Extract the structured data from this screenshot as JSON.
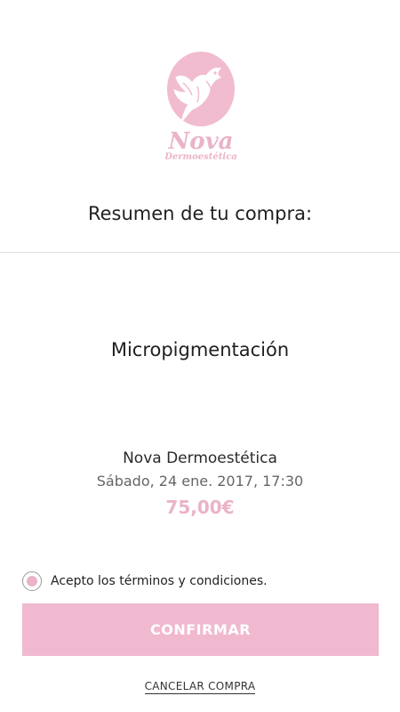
{
  "logo": {
    "brand_name": "Nova",
    "brand_sub": "Dermoestética",
    "icon": "dove-icon",
    "color": "#eab3c9"
  },
  "summary": {
    "title": "Resumen de tu compra:"
  },
  "service": {
    "name": "Micropigmentación"
  },
  "appointment": {
    "business": "Nova Dermoestética",
    "date": "Sábado, 24 ene. 2017, 17:30",
    "price": "75,00€"
  },
  "terms": {
    "label": "Acepto los términos y condiciones.",
    "checked": true
  },
  "actions": {
    "confirm_label": "CONFIRMAR",
    "cancel_label": "CANCELAR COMPRA"
  },
  "colors": {
    "accent": "#f0b9cf",
    "price": "#eab3c9"
  }
}
